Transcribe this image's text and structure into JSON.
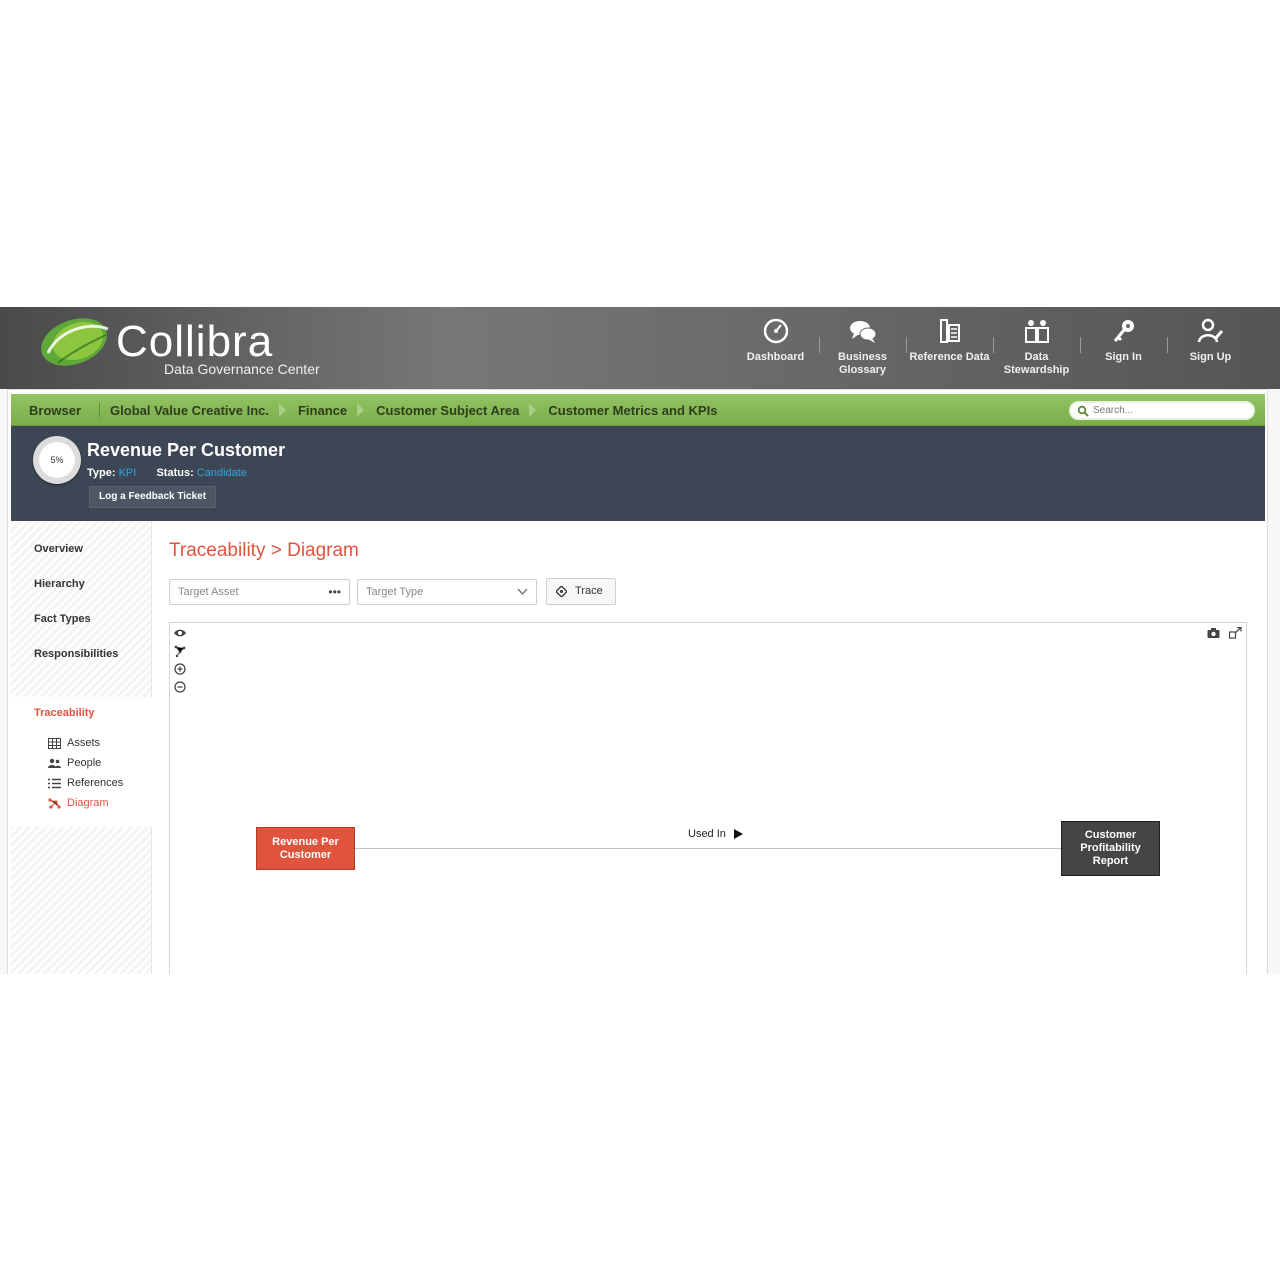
{
  "brand": {
    "name": "Collibra",
    "subtitle": "Data Governance Center"
  },
  "topnav": [
    {
      "label": "Dashboard",
      "icon": "dashboard-gauge-icon"
    },
    {
      "label": "Business Glossary",
      "icon": "speech-bubbles-icon",
      "active": true
    },
    {
      "label": "Reference Data",
      "icon": "reference-data-icon"
    },
    {
      "label": "Data Stewardship",
      "icon": "stewardship-icon"
    },
    {
      "label": "Sign In",
      "icon": "key-icon"
    },
    {
      "label": "Sign Up",
      "icon": "user-pencil-icon"
    }
  ],
  "breadcrumb": {
    "root": "Browser",
    "items": [
      "Global Value Creative Inc.",
      "Finance",
      "Customer Subject Area",
      "Customer Metrics and KPIs"
    ]
  },
  "search": {
    "placeholder": "Search..."
  },
  "asset": {
    "progress_label": "5%",
    "progress_value": 0.05,
    "title": "Revenue Per Customer",
    "type_label": "Type:",
    "type_value": "KPI",
    "status_label": "Status:",
    "status_value": "Candidate",
    "feedback_button": "Log a Feedback Ticket"
  },
  "sidenav": {
    "items": [
      "Overview",
      "Hierarchy",
      "Fact Types",
      "Responsibilities"
    ],
    "traceability": "Traceability",
    "sub_items": [
      {
        "label": "Assets",
        "icon": "table-grid-icon"
      },
      {
        "label": "People",
        "icon": "people-icon"
      },
      {
        "label": "References",
        "icon": "list-icon"
      },
      {
        "label": "Diagram",
        "icon": "diagram-icon",
        "active": true
      }
    ]
  },
  "main": {
    "title": "Traceability > Diagram",
    "target_asset_placeholder": "Target Asset",
    "target_type_placeholder": "Target Type",
    "trace_button": "Trace"
  },
  "diagram": {
    "source_node": "Revenue Per Customer",
    "target_node": "Customer Profitability Report",
    "edge_label": "Used In",
    "colors": {
      "source": "#e0533d",
      "target": "#454545"
    }
  },
  "colors": {
    "accent_green": "#7cad4b",
    "accent_red": "#e0533d",
    "link_blue": "#31a5e3",
    "header_dark": "#3d4654"
  }
}
